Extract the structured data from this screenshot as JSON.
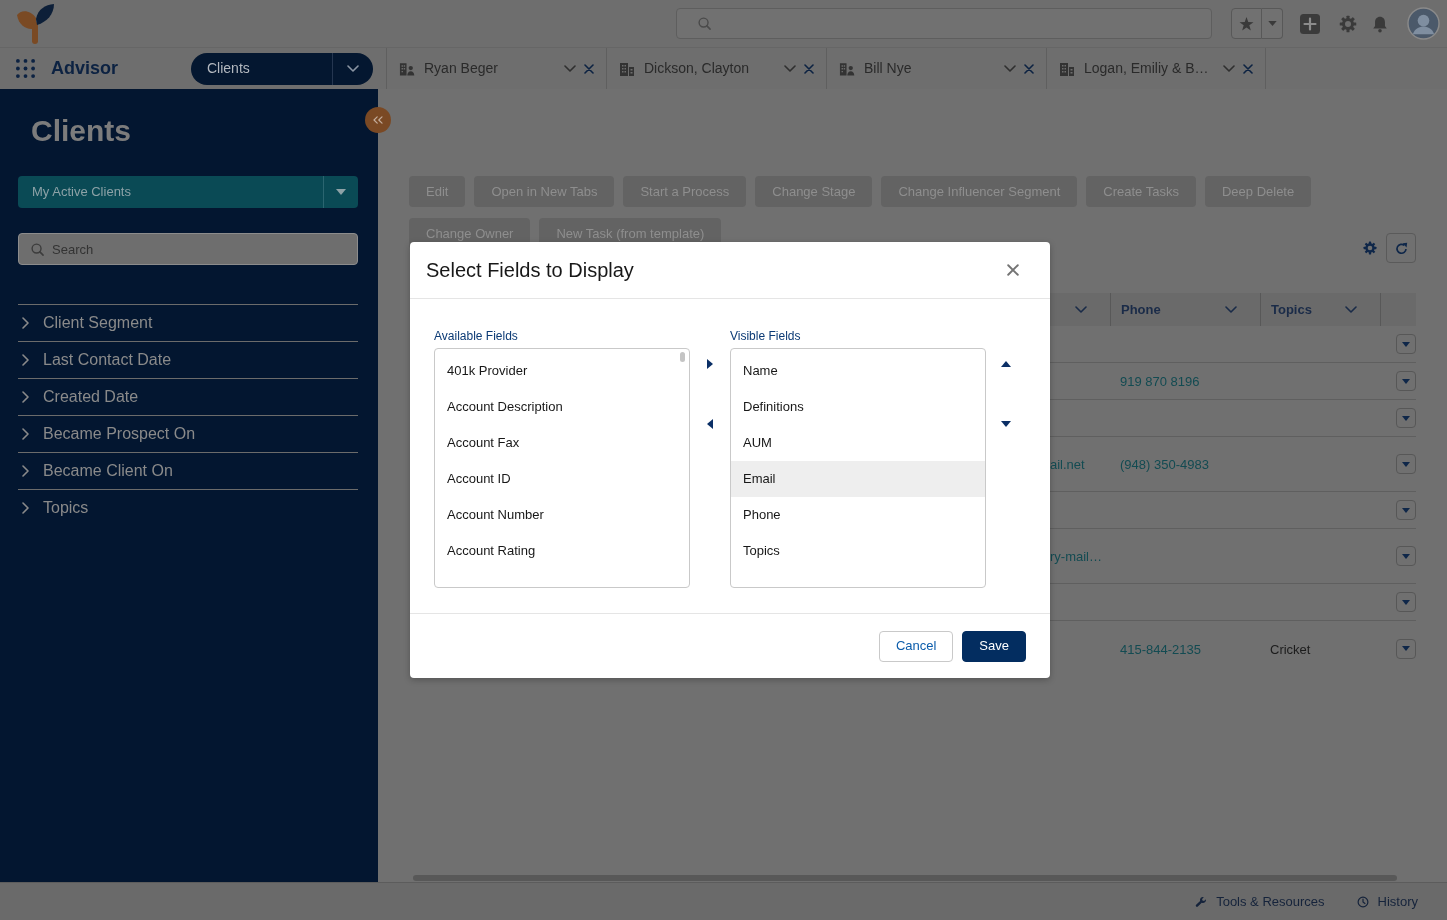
{
  "nav": {
    "app_name": "Advisor",
    "menu": {
      "label": "Clients"
    },
    "tabs": [
      {
        "label": "Ryan Beger",
        "kind": "person",
        "selected": false
      },
      {
        "label": "Dickson, Clayton",
        "kind": "business",
        "selected": false
      },
      {
        "label": "Bill Nye",
        "kind": "person",
        "selected": false
      },
      {
        "label": "Logan, Emiliy & B…",
        "kind": "business",
        "selected": false
      }
    ]
  },
  "sidebar": {
    "title": "Clients",
    "list_view": {
      "label": "My Active Clients"
    },
    "search": {
      "placeholder": "Search"
    },
    "filters": [
      {
        "label": "Client Segment",
        "expanded": false
      },
      {
        "label": "Last Contact Date",
        "expanded": false
      },
      {
        "label": "Created Date",
        "expanded": false
      },
      {
        "label": "Became Prospect On",
        "expanded": false
      },
      {
        "label": "Became Client On",
        "expanded": false
      },
      {
        "label": "Topics",
        "expanded": false
      }
    ]
  },
  "actions": [
    {
      "label": "Edit"
    },
    {
      "label": "Open in New Tabs"
    },
    {
      "label": "Start a Process"
    },
    {
      "label": "Change Stage"
    },
    {
      "label": "Change Influencer Segment"
    },
    {
      "label": "Create Tasks"
    },
    {
      "label": "Deep Delete"
    },
    {
      "label": "Change Owner"
    },
    {
      "label": "New Task (from template)"
    }
  ],
  "table": {
    "columns": [
      {},
      {
        "label": "Phone"
      },
      {
        "label": "Topics"
      }
    ],
    "rows": [
      {},
      {
        "phone": "919 870 8196"
      },
      {},
      {
        "column_1": "ail.net",
        "phone": "(948) 350-4983"
      },
      {},
      {
        "column_1": "ry-mail…"
      },
      {},
      {
        "phone": "415-844-2135",
        "topics": "Cricket"
      }
    ]
  },
  "modal": {
    "title": "Select Fields to Display",
    "available": {
      "label": "Available Fields",
      "items": [
        {
          "label": "401k Provider",
          "selected": false
        },
        {
          "label": "Account Description",
          "selected": false
        },
        {
          "label": "Account Fax",
          "selected": false
        },
        {
          "label": "Account ID",
          "selected": false
        },
        {
          "label": "Account Number",
          "selected": false
        },
        {
          "label": "Account Rating",
          "selected": false
        }
      ]
    },
    "visible": {
      "label": "Visible Fields",
      "items": [
        {
          "label": "Name",
          "selected": false
        },
        {
          "label": "Definitions",
          "selected": false
        },
        {
          "label": "AUM",
          "selected": false
        },
        {
          "label": "Email",
          "selected": true
        },
        {
          "label": "Phone",
          "selected": false
        },
        {
          "label": "Topics",
          "selected": false
        }
      ]
    },
    "cancel": {
      "label": "Cancel"
    },
    "save": {
      "label": "Save"
    }
  },
  "utility_bar": [
    {
      "label": "Tools & Resources",
      "kind": "tools"
    },
    {
      "label": "History",
      "kind": "history"
    }
  ]
}
